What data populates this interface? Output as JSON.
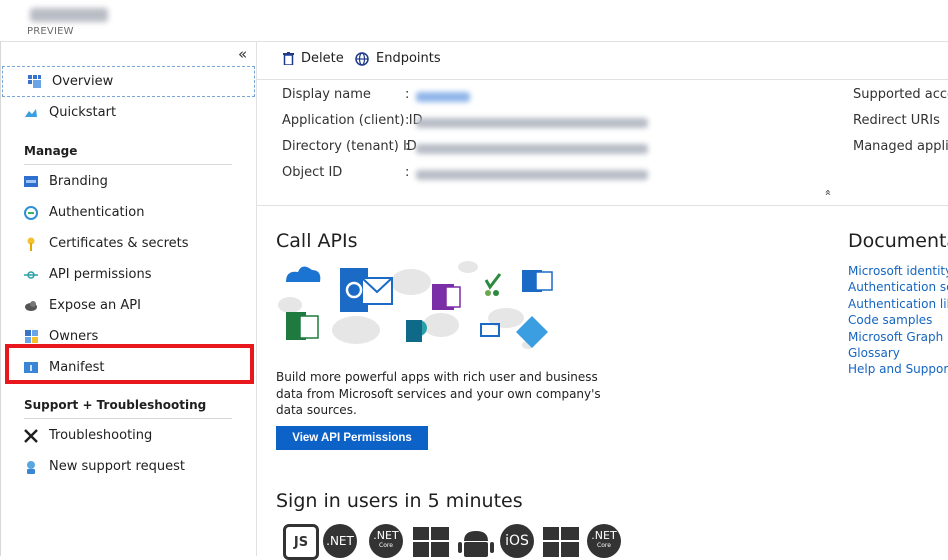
{
  "header": {
    "preview_label": "PREVIEW"
  },
  "sidebar": {
    "collapse_glyph": "«",
    "items": [
      {
        "label": "Overview",
        "icon": "overview-icon",
        "selected": true
      },
      {
        "label": "Quickstart",
        "icon": "quickstart-icon"
      },
      {
        "label": "Branding",
        "icon": "branding-icon"
      },
      {
        "label": "Authentication",
        "icon": "authentication-icon"
      },
      {
        "label": "Certificates & secrets",
        "icon": "key-icon"
      },
      {
        "label": "API permissions",
        "icon": "api-permissions-icon"
      },
      {
        "label": "Expose an API",
        "icon": "cloud-gear-icon"
      },
      {
        "label": "Owners",
        "icon": "owners-icon"
      },
      {
        "label": "Manifest",
        "icon": "manifest-icon",
        "highlighted": true
      },
      {
        "label": "Troubleshooting",
        "icon": "wrench-icon"
      },
      {
        "label": "New support request",
        "icon": "support-icon"
      }
    ],
    "sections": {
      "manage": "Manage",
      "support": "Support + Troubleshooting"
    }
  },
  "toolbar": {
    "delete_label": "Delete",
    "endpoints_label": "Endpoints"
  },
  "essentials": {
    "left": [
      {
        "label": "Display name",
        "colon": ":"
      },
      {
        "label": "Application (client) ID",
        "colon": ":"
      },
      {
        "label": "Directory (tenant) ID",
        "colon": ":"
      },
      {
        "label": "Object ID",
        "colon": ":"
      }
    ],
    "right": [
      "Supported accou",
      "Redirect URIs",
      "Managed applica"
    ],
    "collapse_glyph": "»"
  },
  "call_apis": {
    "title": "Call APIs",
    "description": "Build more powerful apps with rich user and business data from Microsoft services and your own company's data sources.",
    "button": "View API Permissions"
  },
  "documentation": {
    "title": "Documentat",
    "links": [
      "Microsoft identity",
      "Authentication sce",
      "Authentication libr",
      "Code samples",
      "Microsoft Graph",
      "Glossary",
      "Help and Support"
    ]
  },
  "sign_in": {
    "title": "Sign in users in 5 minutes",
    "platforms": [
      "JS",
      ".NET",
      ".NET Core",
      "Windows",
      "Android",
      "iOS",
      "Windows",
      ".NET Core"
    ],
    "platform_text": {
      "dotnet": ".NET",
      "core": "Core",
      "ios": "iOS"
    }
  },
  "colors": {
    "accent": "#0d62c8",
    "highlight": "#e8171c",
    "link": "#1565c0"
  }
}
